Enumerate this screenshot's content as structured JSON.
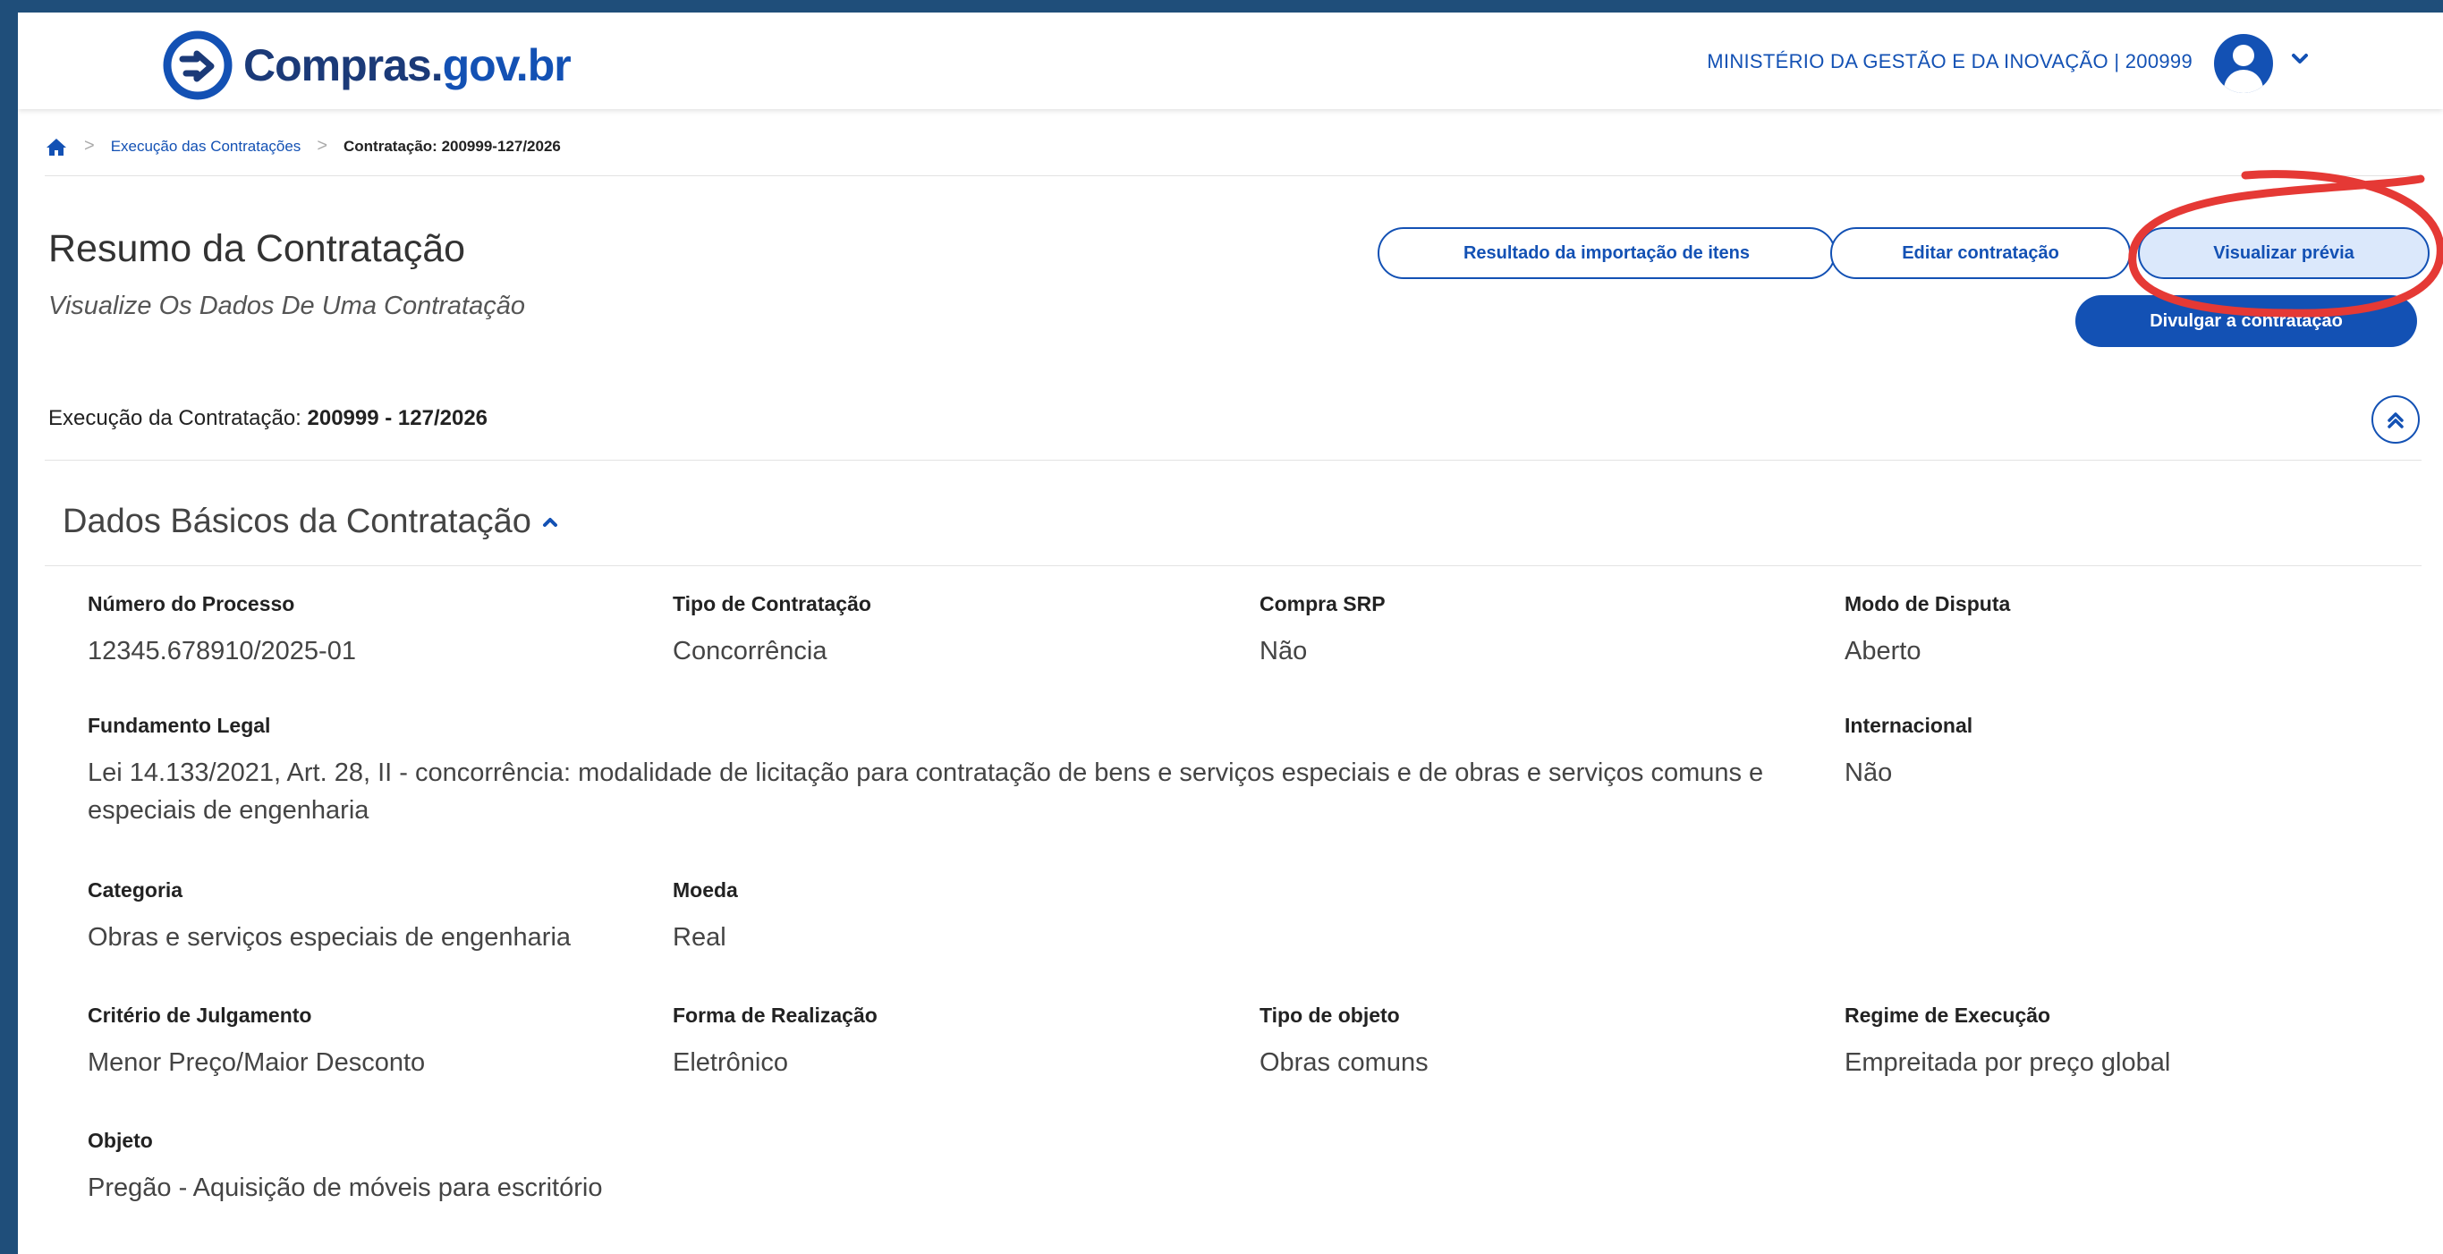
{
  "header": {
    "logo_text_a": "Compras.",
    "logo_text_b": "gov.br",
    "org": "MINISTÉRIO DA GESTÃO E DA INOVAÇÃO | 200999",
    "icons": {
      "home": "home-icon",
      "avatar": "user-avatar-icon",
      "menu": "chevron-down-icon"
    }
  },
  "breadcrumb": {
    "items": [
      "Execução das Contratações"
    ],
    "current": "Contratação: 200999-127/2026"
  },
  "page": {
    "title": "Resumo da Contratação",
    "subtitle": "Visualize Os Dados De Uma Contratação"
  },
  "actions": {
    "import_results": "Resultado da importação de itens",
    "edit": "Editar contratação",
    "preview": "Visualizar prévia",
    "publish": "Divulgar a contratação"
  },
  "execution": {
    "label": "Execução da Contratação:",
    "value": "200999 - 127/2026"
  },
  "section": {
    "title": "Dados Básicos da Contratação",
    "fields": {
      "numero_processo": {
        "label": "Número do Processo",
        "value": "12345.678910/2025-01"
      },
      "tipo_contratacao": {
        "label": "Tipo de Contratação",
        "value": "Concorrência"
      },
      "compra_srp": {
        "label": "Compra SRP",
        "value": "Não"
      },
      "modo_disputa": {
        "label": "Modo de Disputa",
        "value": "Aberto"
      },
      "fundamento_legal": {
        "label": "Fundamento Legal",
        "value": "Lei 14.133/2021, Art. 28, II - concorrência: modalidade de licitação para contratação de bens e serviços especiais e de obras e serviços comuns e especiais de engenharia"
      },
      "internacional": {
        "label": "Internacional",
        "value": "Não"
      },
      "categoria": {
        "label": "Categoria",
        "value": "Obras e serviços especiais de engenharia"
      },
      "moeda": {
        "label": "Moeda",
        "value": "Real"
      },
      "criterio_julgamento": {
        "label": "Critério de Julgamento",
        "value": "Menor Preço/Maior Desconto"
      },
      "forma_realizacao": {
        "label": "Forma de Realização",
        "value": "Eletrônico"
      },
      "tipo_objeto": {
        "label": "Tipo de objeto",
        "value": "Obras comuns"
      },
      "regime_execucao": {
        "label": "Regime de Execução",
        "value": "Empreitada por preço global"
      },
      "objeto": {
        "label": "Objeto",
        "value": "Pregão - Aquisição de móveis para escritório"
      }
    }
  },
  "colors": {
    "brand_blue": "#1351b4",
    "annotation_red": "#e53935",
    "frame": "#1f4e7a"
  }
}
